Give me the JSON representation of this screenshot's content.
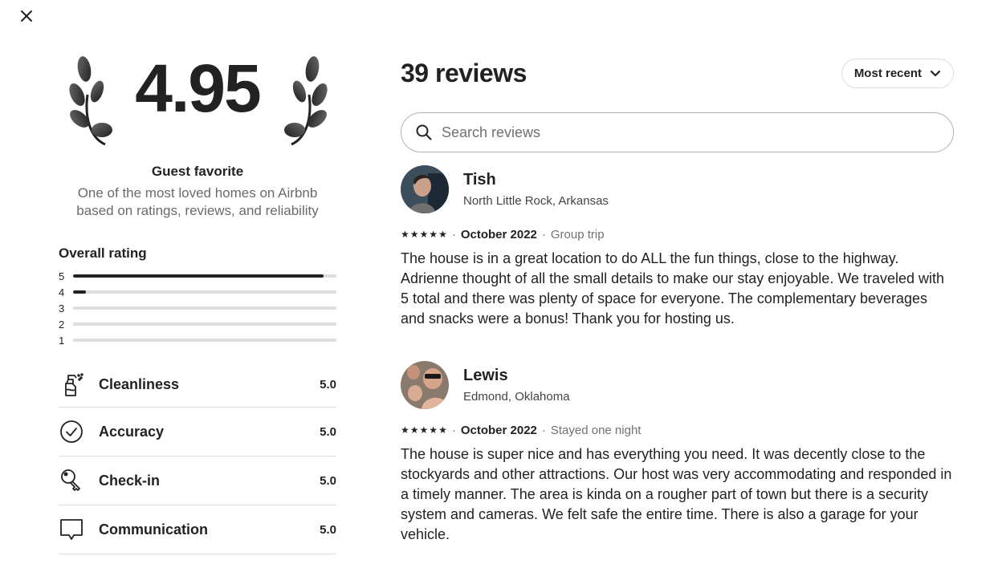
{
  "close": {
    "icon": "close-icon"
  },
  "hero": {
    "score": "4.95",
    "title": "Guest favorite",
    "subtitle": "One of the most loved homes on Airbnb based on ratings, reviews, and reliability"
  },
  "overall": {
    "label": "Overall rating",
    "distribution": [
      {
        "stars": "5",
        "fraction": 0.95
      },
      {
        "stars": "4",
        "fraction": 0.05
      },
      {
        "stars": "3",
        "fraction": 0
      },
      {
        "stars": "2",
        "fraction": 0
      },
      {
        "stars": "1",
        "fraction": 0
      }
    ]
  },
  "categories": [
    {
      "label": "Cleanliness",
      "value": "5.0",
      "icon": "spray-bottle-icon"
    },
    {
      "label": "Accuracy",
      "value": "5.0",
      "icon": "check-circle-icon"
    },
    {
      "label": "Check-in",
      "value": "5.0",
      "icon": "key-icon"
    },
    {
      "label": "Communication",
      "value": "5.0",
      "icon": "chat-bubble-icon"
    }
  ],
  "reviews_panel": {
    "count_label": "39 reviews",
    "sort_label": "Most recent",
    "search_placeholder": "Search reviews"
  },
  "reviews": [
    {
      "name": "Tish",
      "location": "North Little Rock, Arkansas",
      "rating": 5,
      "date": "October 2022",
      "trip_type": "Group trip",
      "text": "The house is in a great location to do ALL the fun things, close to the highway. Adrienne thought of all the small details to make our stay enjoyable. We traveled with 5 total and there was plenty of space for everyone. The complementary beverages and snacks were a bonus! Thank you for hosting us."
    },
    {
      "name": "Lewis",
      "location": "Edmond, Oklahoma",
      "rating": 5,
      "date": "October 2022",
      "trip_type": "Stayed one night",
      "text": "The house is super nice and has everything you need. It was decently close to the stockyards and other attractions. Our host was very accommodating and responded in a timely manner. The area is kinda on a rougher part of town but there is a security system and cameras. We felt safe the entire time. There is also a garage for your vehicle."
    }
  ]
}
